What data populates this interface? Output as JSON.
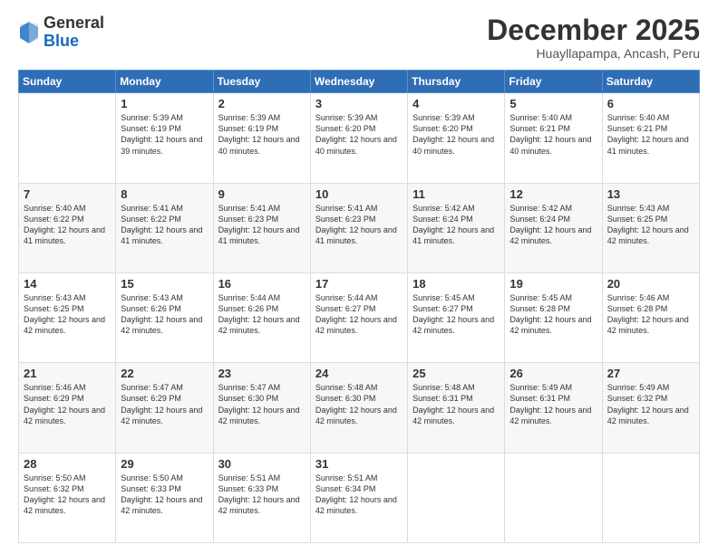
{
  "header": {
    "logo_general": "General",
    "logo_blue": "Blue",
    "month_title": "December 2025",
    "location": "Huayllapampa, Ancash, Peru"
  },
  "days_of_week": [
    "Sunday",
    "Monday",
    "Tuesday",
    "Wednesday",
    "Thursday",
    "Friday",
    "Saturday"
  ],
  "weeks": [
    [
      {
        "day": "",
        "empty": true
      },
      {
        "day": "1",
        "sunrise": "Sunrise: 5:39 AM",
        "sunset": "Sunset: 6:19 PM",
        "daylight": "Daylight: 12 hours and 39 minutes."
      },
      {
        "day": "2",
        "sunrise": "Sunrise: 5:39 AM",
        "sunset": "Sunset: 6:19 PM",
        "daylight": "Daylight: 12 hours and 40 minutes."
      },
      {
        "day": "3",
        "sunrise": "Sunrise: 5:39 AM",
        "sunset": "Sunset: 6:20 PM",
        "daylight": "Daylight: 12 hours and 40 minutes."
      },
      {
        "day": "4",
        "sunrise": "Sunrise: 5:39 AM",
        "sunset": "Sunset: 6:20 PM",
        "daylight": "Daylight: 12 hours and 40 minutes."
      },
      {
        "day": "5",
        "sunrise": "Sunrise: 5:40 AM",
        "sunset": "Sunset: 6:21 PM",
        "daylight": "Daylight: 12 hours and 40 minutes."
      },
      {
        "day": "6",
        "sunrise": "Sunrise: 5:40 AM",
        "sunset": "Sunset: 6:21 PM",
        "daylight": "Daylight: 12 hours and 41 minutes."
      }
    ],
    [
      {
        "day": "7",
        "sunrise": "Sunrise: 5:40 AM",
        "sunset": "Sunset: 6:22 PM",
        "daylight": "Daylight: 12 hours and 41 minutes."
      },
      {
        "day": "8",
        "sunrise": "Sunrise: 5:41 AM",
        "sunset": "Sunset: 6:22 PM",
        "daylight": "Daylight: 12 hours and 41 minutes."
      },
      {
        "day": "9",
        "sunrise": "Sunrise: 5:41 AM",
        "sunset": "Sunset: 6:23 PM",
        "daylight": "Daylight: 12 hours and 41 minutes."
      },
      {
        "day": "10",
        "sunrise": "Sunrise: 5:41 AM",
        "sunset": "Sunset: 6:23 PM",
        "daylight": "Daylight: 12 hours and 41 minutes."
      },
      {
        "day": "11",
        "sunrise": "Sunrise: 5:42 AM",
        "sunset": "Sunset: 6:24 PM",
        "daylight": "Daylight: 12 hours and 41 minutes."
      },
      {
        "day": "12",
        "sunrise": "Sunrise: 5:42 AM",
        "sunset": "Sunset: 6:24 PM",
        "daylight": "Daylight: 12 hours and 42 minutes."
      },
      {
        "day": "13",
        "sunrise": "Sunrise: 5:43 AM",
        "sunset": "Sunset: 6:25 PM",
        "daylight": "Daylight: 12 hours and 42 minutes."
      }
    ],
    [
      {
        "day": "14",
        "sunrise": "Sunrise: 5:43 AM",
        "sunset": "Sunset: 6:25 PM",
        "daylight": "Daylight: 12 hours and 42 minutes."
      },
      {
        "day": "15",
        "sunrise": "Sunrise: 5:43 AM",
        "sunset": "Sunset: 6:26 PM",
        "daylight": "Daylight: 12 hours and 42 minutes."
      },
      {
        "day": "16",
        "sunrise": "Sunrise: 5:44 AM",
        "sunset": "Sunset: 6:26 PM",
        "daylight": "Daylight: 12 hours and 42 minutes."
      },
      {
        "day": "17",
        "sunrise": "Sunrise: 5:44 AM",
        "sunset": "Sunset: 6:27 PM",
        "daylight": "Daylight: 12 hours and 42 minutes."
      },
      {
        "day": "18",
        "sunrise": "Sunrise: 5:45 AM",
        "sunset": "Sunset: 6:27 PM",
        "daylight": "Daylight: 12 hours and 42 minutes."
      },
      {
        "day": "19",
        "sunrise": "Sunrise: 5:45 AM",
        "sunset": "Sunset: 6:28 PM",
        "daylight": "Daylight: 12 hours and 42 minutes."
      },
      {
        "day": "20",
        "sunrise": "Sunrise: 5:46 AM",
        "sunset": "Sunset: 6:28 PM",
        "daylight": "Daylight: 12 hours and 42 minutes."
      }
    ],
    [
      {
        "day": "21",
        "sunrise": "Sunrise: 5:46 AM",
        "sunset": "Sunset: 6:29 PM",
        "daylight": "Daylight: 12 hours and 42 minutes."
      },
      {
        "day": "22",
        "sunrise": "Sunrise: 5:47 AM",
        "sunset": "Sunset: 6:29 PM",
        "daylight": "Daylight: 12 hours and 42 minutes."
      },
      {
        "day": "23",
        "sunrise": "Sunrise: 5:47 AM",
        "sunset": "Sunset: 6:30 PM",
        "daylight": "Daylight: 12 hours and 42 minutes."
      },
      {
        "day": "24",
        "sunrise": "Sunrise: 5:48 AM",
        "sunset": "Sunset: 6:30 PM",
        "daylight": "Daylight: 12 hours and 42 minutes."
      },
      {
        "day": "25",
        "sunrise": "Sunrise: 5:48 AM",
        "sunset": "Sunset: 6:31 PM",
        "daylight": "Daylight: 12 hours and 42 minutes."
      },
      {
        "day": "26",
        "sunrise": "Sunrise: 5:49 AM",
        "sunset": "Sunset: 6:31 PM",
        "daylight": "Daylight: 12 hours and 42 minutes."
      },
      {
        "day": "27",
        "sunrise": "Sunrise: 5:49 AM",
        "sunset": "Sunset: 6:32 PM",
        "daylight": "Daylight: 12 hours and 42 minutes."
      }
    ],
    [
      {
        "day": "28",
        "sunrise": "Sunrise: 5:50 AM",
        "sunset": "Sunset: 6:32 PM",
        "daylight": "Daylight: 12 hours and 42 minutes."
      },
      {
        "day": "29",
        "sunrise": "Sunrise: 5:50 AM",
        "sunset": "Sunset: 6:33 PM",
        "daylight": "Daylight: 12 hours and 42 minutes."
      },
      {
        "day": "30",
        "sunrise": "Sunrise: 5:51 AM",
        "sunset": "Sunset: 6:33 PM",
        "daylight": "Daylight: 12 hours and 42 minutes."
      },
      {
        "day": "31",
        "sunrise": "Sunrise: 5:51 AM",
        "sunset": "Sunset: 6:34 PM",
        "daylight": "Daylight: 12 hours and 42 minutes."
      },
      {
        "day": "",
        "empty": true
      },
      {
        "day": "",
        "empty": true
      },
      {
        "day": "",
        "empty": true
      }
    ]
  ]
}
